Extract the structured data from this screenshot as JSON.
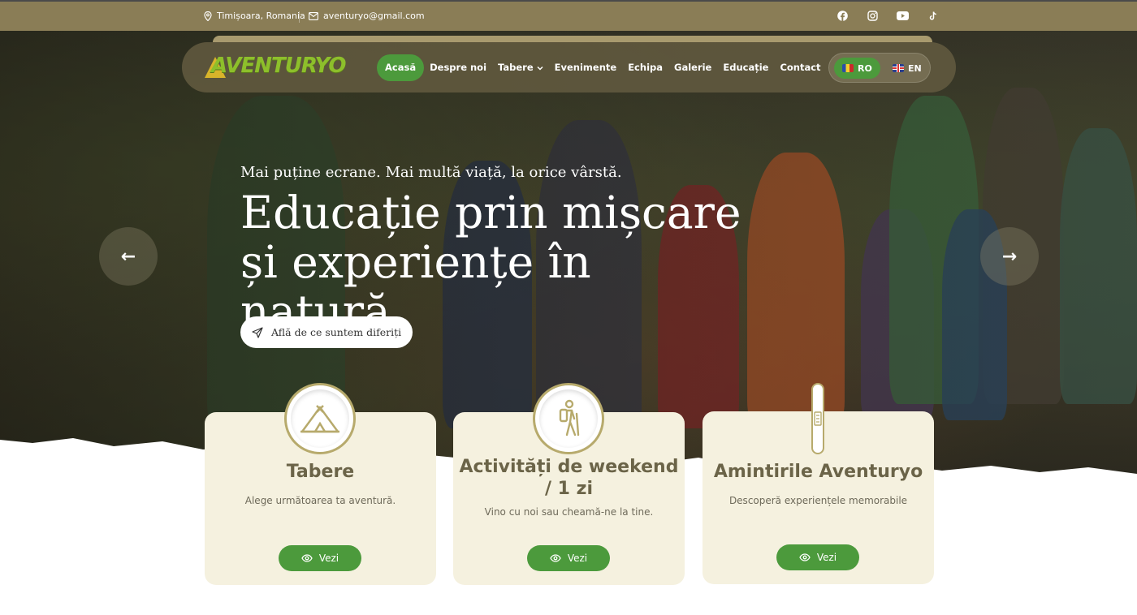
{
  "topbar": {
    "location": "Timișoara, Romania",
    "email": "aventuryo@gmail.com",
    "socials": [
      "facebook-icon",
      "instagram-icon",
      "youtube-icon",
      "tiktok-icon"
    ]
  },
  "nav": {
    "logo": "AVENTURYO",
    "items": [
      {
        "label": "Acasă",
        "active": true
      },
      {
        "label": "Despre noi"
      },
      {
        "label": "Tabere",
        "dropdown": true
      },
      {
        "label": "Evenimente"
      },
      {
        "label": "Echipa"
      },
      {
        "label": "Galerie"
      },
      {
        "label": "Educație"
      },
      {
        "label": "Contact"
      }
    ],
    "languages": [
      {
        "code": "RO",
        "active": true
      },
      {
        "code": "EN"
      }
    ]
  },
  "hero": {
    "tagline": "Mai puține ecrane. Mai multă viață, la orice vârstă.",
    "headline": "Educație prin mișcare și experiențe în natură",
    "cta": "Află de ce suntem diferiți",
    "prev": "←",
    "next": "→"
  },
  "cards": [
    {
      "title": "Tabere",
      "text": "Alege următoarea ta aventură.",
      "button": "Vezi",
      "icon": "tent-icon"
    },
    {
      "title": "Activități de weekend / 1 zi",
      "text": "Vino cu noi sau cheamă-ne la tine.",
      "button": "Vezi",
      "icon": "hiker-icon"
    },
    {
      "title": "Amintirile Aventuryo",
      "text": "Descoperă experiențele memorabile",
      "button": "Vezi",
      "icon": "photo-icon"
    }
  ],
  "colors": {
    "topbar": "#8a7d56",
    "accent_green": "#4c9a3c",
    "card_bg": "#f5f1df",
    "card_title": "#6b6448"
  }
}
